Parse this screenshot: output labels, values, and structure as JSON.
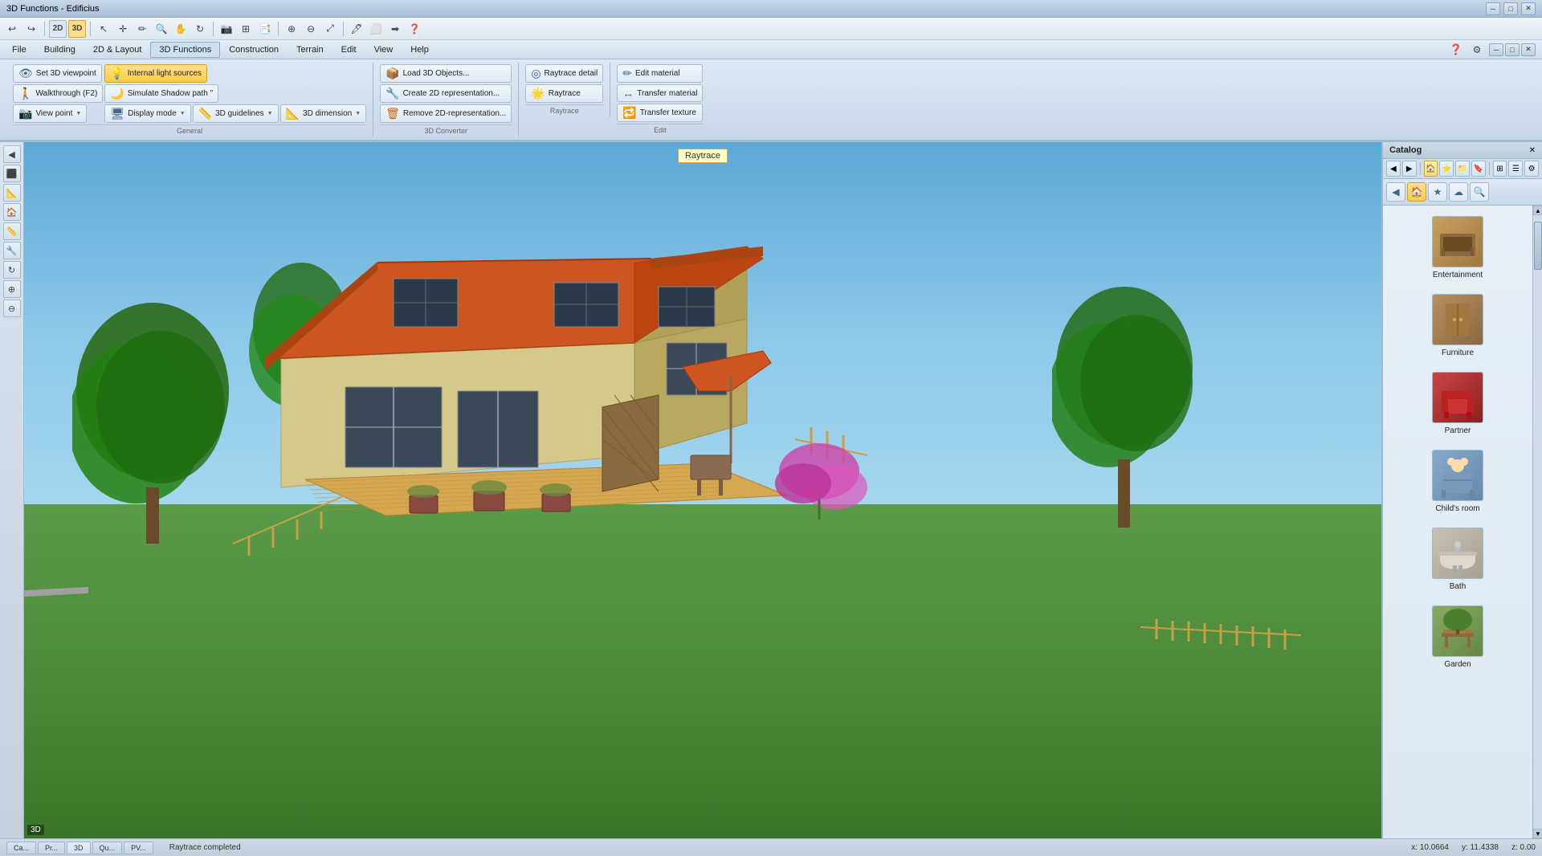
{
  "window": {
    "title": "3D Functions - Edificius"
  },
  "titlebar": {
    "minimize": "─",
    "restore": "□",
    "close": "✕"
  },
  "menubar": {
    "items": [
      "File",
      "Building",
      "2D & Layout",
      "3D Functions",
      "Construction",
      "Terrain",
      "Edit",
      "View",
      "Help"
    ]
  },
  "toolbar_icons": [
    "↩",
    "↪",
    "🔧",
    "📐",
    "🔲",
    "◻",
    "▦",
    "⬛",
    "✏",
    "↕",
    "🔀",
    "📷",
    "📋",
    "🔍",
    "+",
    "−"
  ],
  "ribbon": {
    "groups": [
      {
        "label": "General",
        "buttons": [
          {
            "id": "set-3d-viewpoint",
            "label": "Set 3D viewpoint",
            "icon": "👁",
            "active": false,
            "dropdown": false
          },
          {
            "id": "walkthrough",
            "label": "Walkthrough (F2)",
            "icon": "🚶",
            "active": false,
            "dropdown": false
          },
          {
            "id": "view-point",
            "label": "View point",
            "icon": "📐",
            "active": false,
            "dropdown": true
          },
          {
            "id": "simulate-shadow",
            "label": "Simulate Shadow path \"",
            "icon": "🌙",
            "active": false,
            "dropdown": false
          },
          {
            "id": "display-mode",
            "label": "Display mode",
            "icon": "🖥",
            "active": false,
            "dropdown": true
          },
          {
            "id": "3d-guidelines",
            "label": "3D guidelines",
            "icon": "📏",
            "active": false,
            "dropdown": true
          },
          {
            "id": "3d-dimension",
            "label": "3D dimension",
            "icon": "📐",
            "active": false,
            "dropdown": true
          }
        ]
      },
      {
        "label": "3D Converter",
        "buttons": [
          {
            "id": "load-3d-objects",
            "label": "Load 3D Objects...",
            "icon": "📦",
            "active": false,
            "dropdown": false
          },
          {
            "id": "create-2d-rep",
            "label": "Create 2D representation...",
            "icon": "🔧",
            "active": false,
            "dropdown": false
          },
          {
            "id": "remove-2d-rep",
            "label": "Remove 2D-representation...",
            "icon": "🗑",
            "active": false,
            "dropdown": false
          }
        ]
      },
      {
        "label": "Raytrace",
        "buttons": [
          {
            "id": "raytrace-detail",
            "label": "Raytrace detail",
            "icon": "🔆",
            "active": false,
            "dropdown": false
          },
          {
            "id": "raytrace",
            "label": "Raytrace",
            "icon": "🌟",
            "active": false,
            "dropdown": false
          }
        ]
      },
      {
        "label": "Edit",
        "buttons": [
          {
            "id": "edit-material",
            "label": "Edit material",
            "icon": "✏",
            "active": false,
            "dropdown": false
          },
          {
            "id": "transfer-material",
            "label": "Transfer material",
            "icon": "↔",
            "active": false,
            "dropdown": false
          },
          {
            "id": "transfer-texture",
            "label": "Transfer texture",
            "icon": "🔁",
            "active": false,
            "dropdown": false
          }
        ]
      }
    ],
    "highlighted_btn": "internal-light-sources",
    "internal_light_label": "Internal light sources"
  },
  "raytrace_tooltip": "Raytrace",
  "catalog": {
    "header_label": "Catalog",
    "nav_buttons": [
      "◀",
      "▶",
      "🏠",
      "⭐",
      "📁",
      "🔖"
    ],
    "items": [
      {
        "id": "entertainment",
        "label": "Entertainment",
        "icon": "🎵",
        "thumb_class": "thumb-entertainment"
      },
      {
        "id": "furniture",
        "label": "Furniture",
        "icon": "🪑",
        "thumb_class": "thumb-furniture"
      },
      {
        "id": "partner",
        "label": "Partner",
        "icon": "🔴",
        "thumb_class": "thumb-partner"
      },
      {
        "id": "childs-room",
        "label": "Child's room",
        "icon": "🧸",
        "thumb_class": "thumb-childroom"
      },
      {
        "id": "bath",
        "label": "Bath",
        "icon": "🛁",
        "thumb_class": "thumb-bath"
      },
      {
        "id": "garden",
        "label": "Garden",
        "icon": "🌿",
        "thumb_class": "thumb-garden"
      }
    ]
  },
  "statusbar": {
    "left_text": "Raytrace completed",
    "coords": {
      "x": "x: 10.0664",
      "y": "y: 11.4338",
      "z": "z: 0.00"
    },
    "tabs": [
      "Ca...",
      "Pr...",
      "3D",
      "Qu...",
      "PV..."
    ]
  }
}
